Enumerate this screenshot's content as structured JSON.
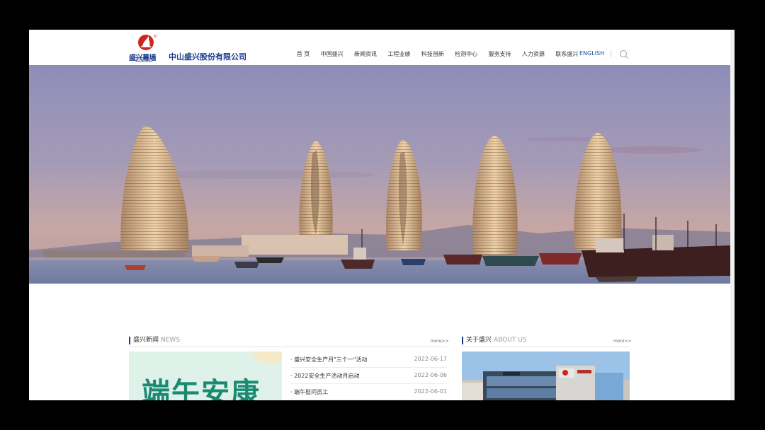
{
  "header": {
    "company_name": "中山盛兴股份有限公司",
    "logo_text": "盛兴幕墙",
    "logo_sub": "SHENGXING",
    "nav": [
      "首 页",
      "中国盛兴",
      "新闻资讯",
      "工程业绩",
      "科技创新",
      "检测中心",
      "服务支持",
      "人力资源",
      "联系盛兴"
    ],
    "english_link": "ENGLISH",
    "search_icon": "search-icon"
  },
  "news": {
    "title_cn": "盛兴新闻",
    "title_en": "NEWS",
    "more": "more>>",
    "image_text": "端午安康",
    "items": [
      {
        "title": "· 盛兴安全生产月\"三个一\"活动",
        "date": "2022-06-17"
      },
      {
        "title": "· 2022安全生产活动月启动",
        "date": "2022-06-06"
      },
      {
        "title": "· 端午慰问员工",
        "date": "2022-06-01"
      }
    ]
  },
  "about": {
    "title_cn": "关于盛兴",
    "title_en": "ABOUT US",
    "more": "more>>"
  },
  "colors": {
    "brand_blue": "#1b3a8c",
    "logo_red": "#d0261f",
    "news_green": "#1a8a72"
  }
}
